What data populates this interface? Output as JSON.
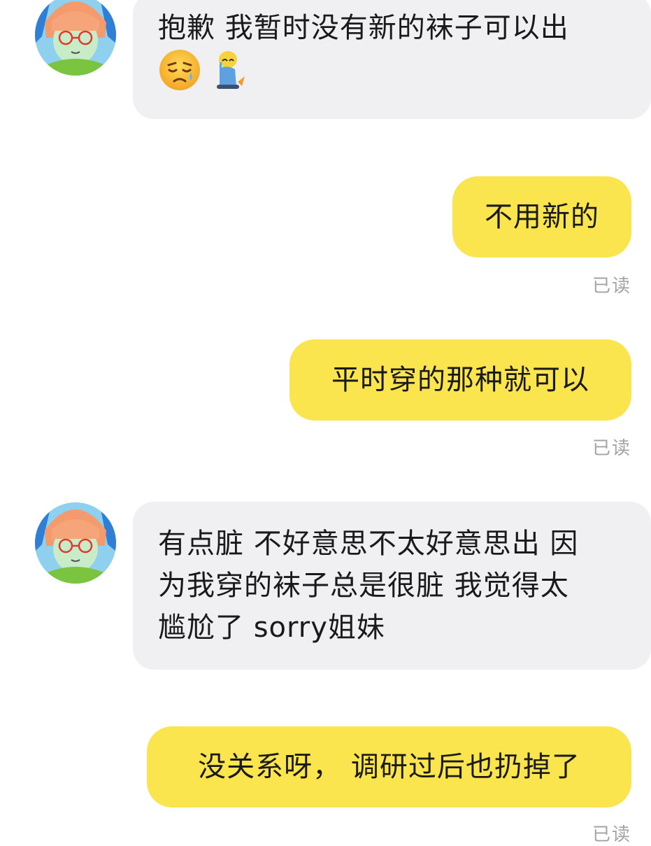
{
  "messages": [
    {
      "sender": "other",
      "lines": [
        "抱歉 我暂时没有新的袜子可以出"
      ],
      "emojis": [
        "disappointed-relieved-face-emoji",
        "crying-sticker-emoji"
      ]
    },
    {
      "sender": "me",
      "text": "不用新的",
      "status": "已读"
    },
    {
      "sender": "me",
      "text": "平时穿的那种就可以",
      "status": "已读"
    },
    {
      "sender": "other",
      "lines": [
        "有点脏 不好意思不太好意思出 因",
        "为我穿的袜子总是很脏 我觉得太",
        "尴尬了 sorry姐妹"
      ]
    },
    {
      "sender": "me",
      "text": "没关系呀， 调研过后也扔掉了",
      "status": "已读"
    }
  ],
  "colors": {
    "background": "#ffffff",
    "incoming_bubble": "#f0f0f2",
    "outgoing_bubble": "#fae54f",
    "read_status_text": "#a3a3a3"
  }
}
